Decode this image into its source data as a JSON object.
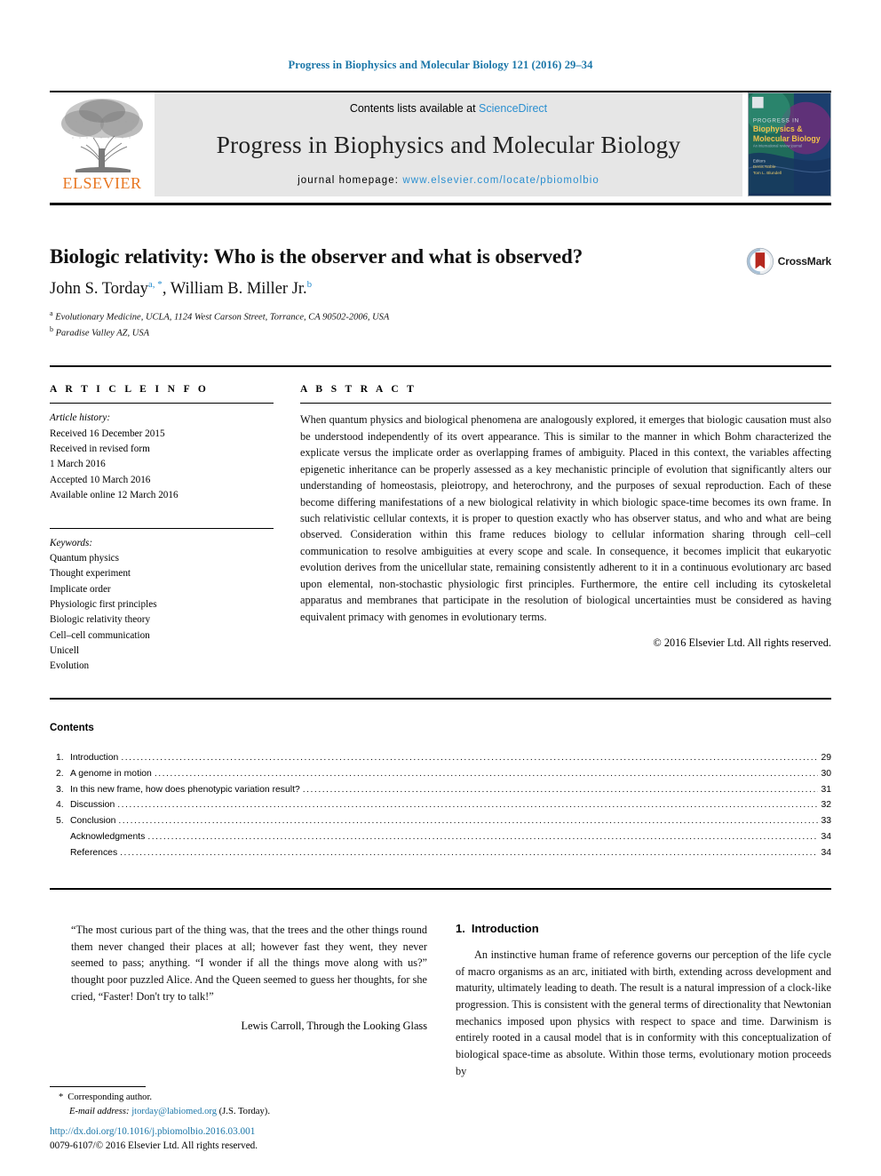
{
  "running_head": "Progress in Biophysics and Molecular Biology 121 (2016) 29–34",
  "masthead": {
    "publisher_name": "ELSEVIER",
    "contents_prefix": "Contents lists available at ",
    "contents_link": "ScienceDirect",
    "journal_title": "Progress in Biophysics and Molecular Biology",
    "homepage_prefix": "journal homepage: ",
    "homepage_url": "www.elsevier.com/locate/pbiomolbio",
    "cover_lines": {
      "line1": "PROGRESS IN",
      "line2": "Biophysics &",
      "line3": "Molecular Biology",
      "line4": "Editors",
      "line5": "Denis Noble",
      "line6": "Tom L. Blundell"
    }
  },
  "article": {
    "title": "Biologic relativity: Who is the observer and what is observed?",
    "authors": "John S. Torday",
    "author1_marks": "a, *",
    "authors2": ", William B. Miller Jr.",
    "author2_marks": "b",
    "affiliations": [
      {
        "mark": "a",
        "text": "Evolutionary Medicine, UCLA, 1124 West Carson Street, Torrance, CA 90502-2006, USA"
      },
      {
        "mark": "b",
        "text": "Paradise Valley AZ, USA"
      }
    ],
    "crossmark_label": "CrossMark"
  },
  "article_info": {
    "heading": "A R T I C L E  I N F O",
    "history_label": "Article history:",
    "history": [
      "Received 16 December 2015",
      "Received in revised form",
      "1 March 2016",
      "Accepted 10 March 2016",
      "Available online 12 March 2016"
    ],
    "keywords_label": "Keywords:",
    "keywords": [
      "Quantum physics",
      "Thought experiment",
      "Implicate order",
      "Physiologic first principles",
      "Biologic relativity theory",
      "Cell–cell communication",
      "Unicell",
      "Evolution"
    ]
  },
  "abstract": {
    "heading": "A B S T R A C T",
    "text": "When quantum physics and biological phenomena are analogously explored, it emerges that biologic causation must also be understood independently of its overt appearance. This is similar to the manner in which Bohm characterized the explicate versus the implicate order as overlapping frames of ambiguity. Placed in this context, the variables affecting epigenetic inheritance can be properly assessed as a key mechanistic principle of evolution that significantly alters our understanding of homeostasis, pleiotropy, and heterochrony, and the purposes of sexual reproduction. Each of these become differing manifestations of a new biological relativity in which biologic space-time becomes its own frame. In such relativistic cellular contexts, it is proper to question exactly who has observer status, and who and what are being observed. Consideration within this frame reduces biology to cellular information sharing through cell–cell communication to resolve ambiguities at every scope and scale. In consequence, it becomes implicit that eukaryotic evolution derives from the unicellular state, remaining consistently adherent to it in a continuous evolutionary arc based upon elemental, non-stochastic physiologic first principles. Furthermore, the entire cell including its cytoskeletal apparatus and membranes that participate in the resolution of biological uncertainties must be considered as having equivalent primacy with genomes in evolutionary terms.",
    "copyright": "© 2016 Elsevier Ltd. All rights reserved."
  },
  "contents": {
    "title": "Contents",
    "rows": [
      {
        "num": "1.",
        "label": "Introduction",
        "page": "29"
      },
      {
        "num": "2.",
        "label": "A genome in motion",
        "page": "30"
      },
      {
        "num": "3.",
        "label": "In this new frame, how does phenotypic variation result?",
        "page": "31"
      },
      {
        "num": "4.",
        "label": "Discussion",
        "page": "32"
      },
      {
        "num": "5.",
        "label": "Conclusion",
        "page": "33"
      },
      {
        "num": "",
        "label": "Acknowledgments",
        "page": "34"
      },
      {
        "num": "",
        "label": "References",
        "page": "34"
      }
    ]
  },
  "epigraph": {
    "text": "“The most curious part of the thing was, that the trees and the other things round them never changed their places at all; however fast they went, they never seemed to pass; anything. “I wonder if all the things move along with us?” thought poor puzzled Alice. And the Queen seemed to guess her thoughts, for she cried, “Faster! Don't try to talk!”",
    "attribution": "Lewis Carroll, Through the Looking Glass"
  },
  "introduction": {
    "number": "1.",
    "heading": "Introduction",
    "paragraph": "An instinctive human frame of reference governs our perception of the life cycle of macro organisms as an arc, initiated with birth, extending across development and maturity, ultimately leading to death. The result is a natural impression of a clock-like progression. This is consistent with the general terms of directionality that Newtonian mechanics imposed upon physics with respect to space and time. Darwinism is entirely rooted in a causal model that is in conformity with this conceptualization of biological space-time as absolute. Within those terms, evolutionary motion proceeds by"
  },
  "footnote": {
    "star": "*",
    "corresponding": "Corresponding author.",
    "email_label": "E-mail address:",
    "email": "jtorday@labiomed.org",
    "email_suffix": "(J.S. Torday)."
  },
  "doc_footer": {
    "doi": "http://dx.doi.org/10.1016/j.pbiomolbio.2016.03.001",
    "issn_line": "0079-6107/© 2016 Elsevier Ltd. All rights reserved."
  },
  "colors": {
    "link_blue": "#1b76a8",
    "sd_blue": "#2b8fd0",
    "elsevier_orange": "#e87722"
  }
}
